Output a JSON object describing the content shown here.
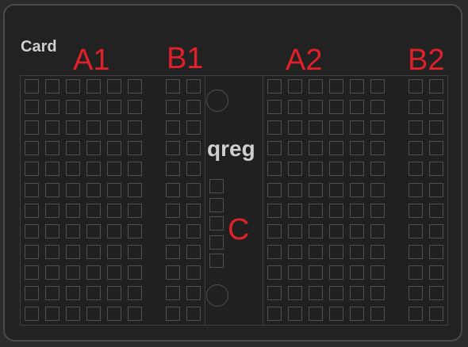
{
  "card": {
    "title": "Card"
  },
  "regions": {
    "a1": "A1",
    "b1": "B1",
    "a2": "A2",
    "b2": "B2",
    "center": "qreg",
    "c": "C"
  },
  "colors": {
    "label_red": "#e0202a",
    "background": "#222222",
    "border": "#4a4a4a",
    "text": "#cfcfcf"
  },
  "grid": {
    "rows": 12,
    "a_columns": 6,
    "b_columns": 2,
    "c_slots": 5,
    "rings": 2
  }
}
